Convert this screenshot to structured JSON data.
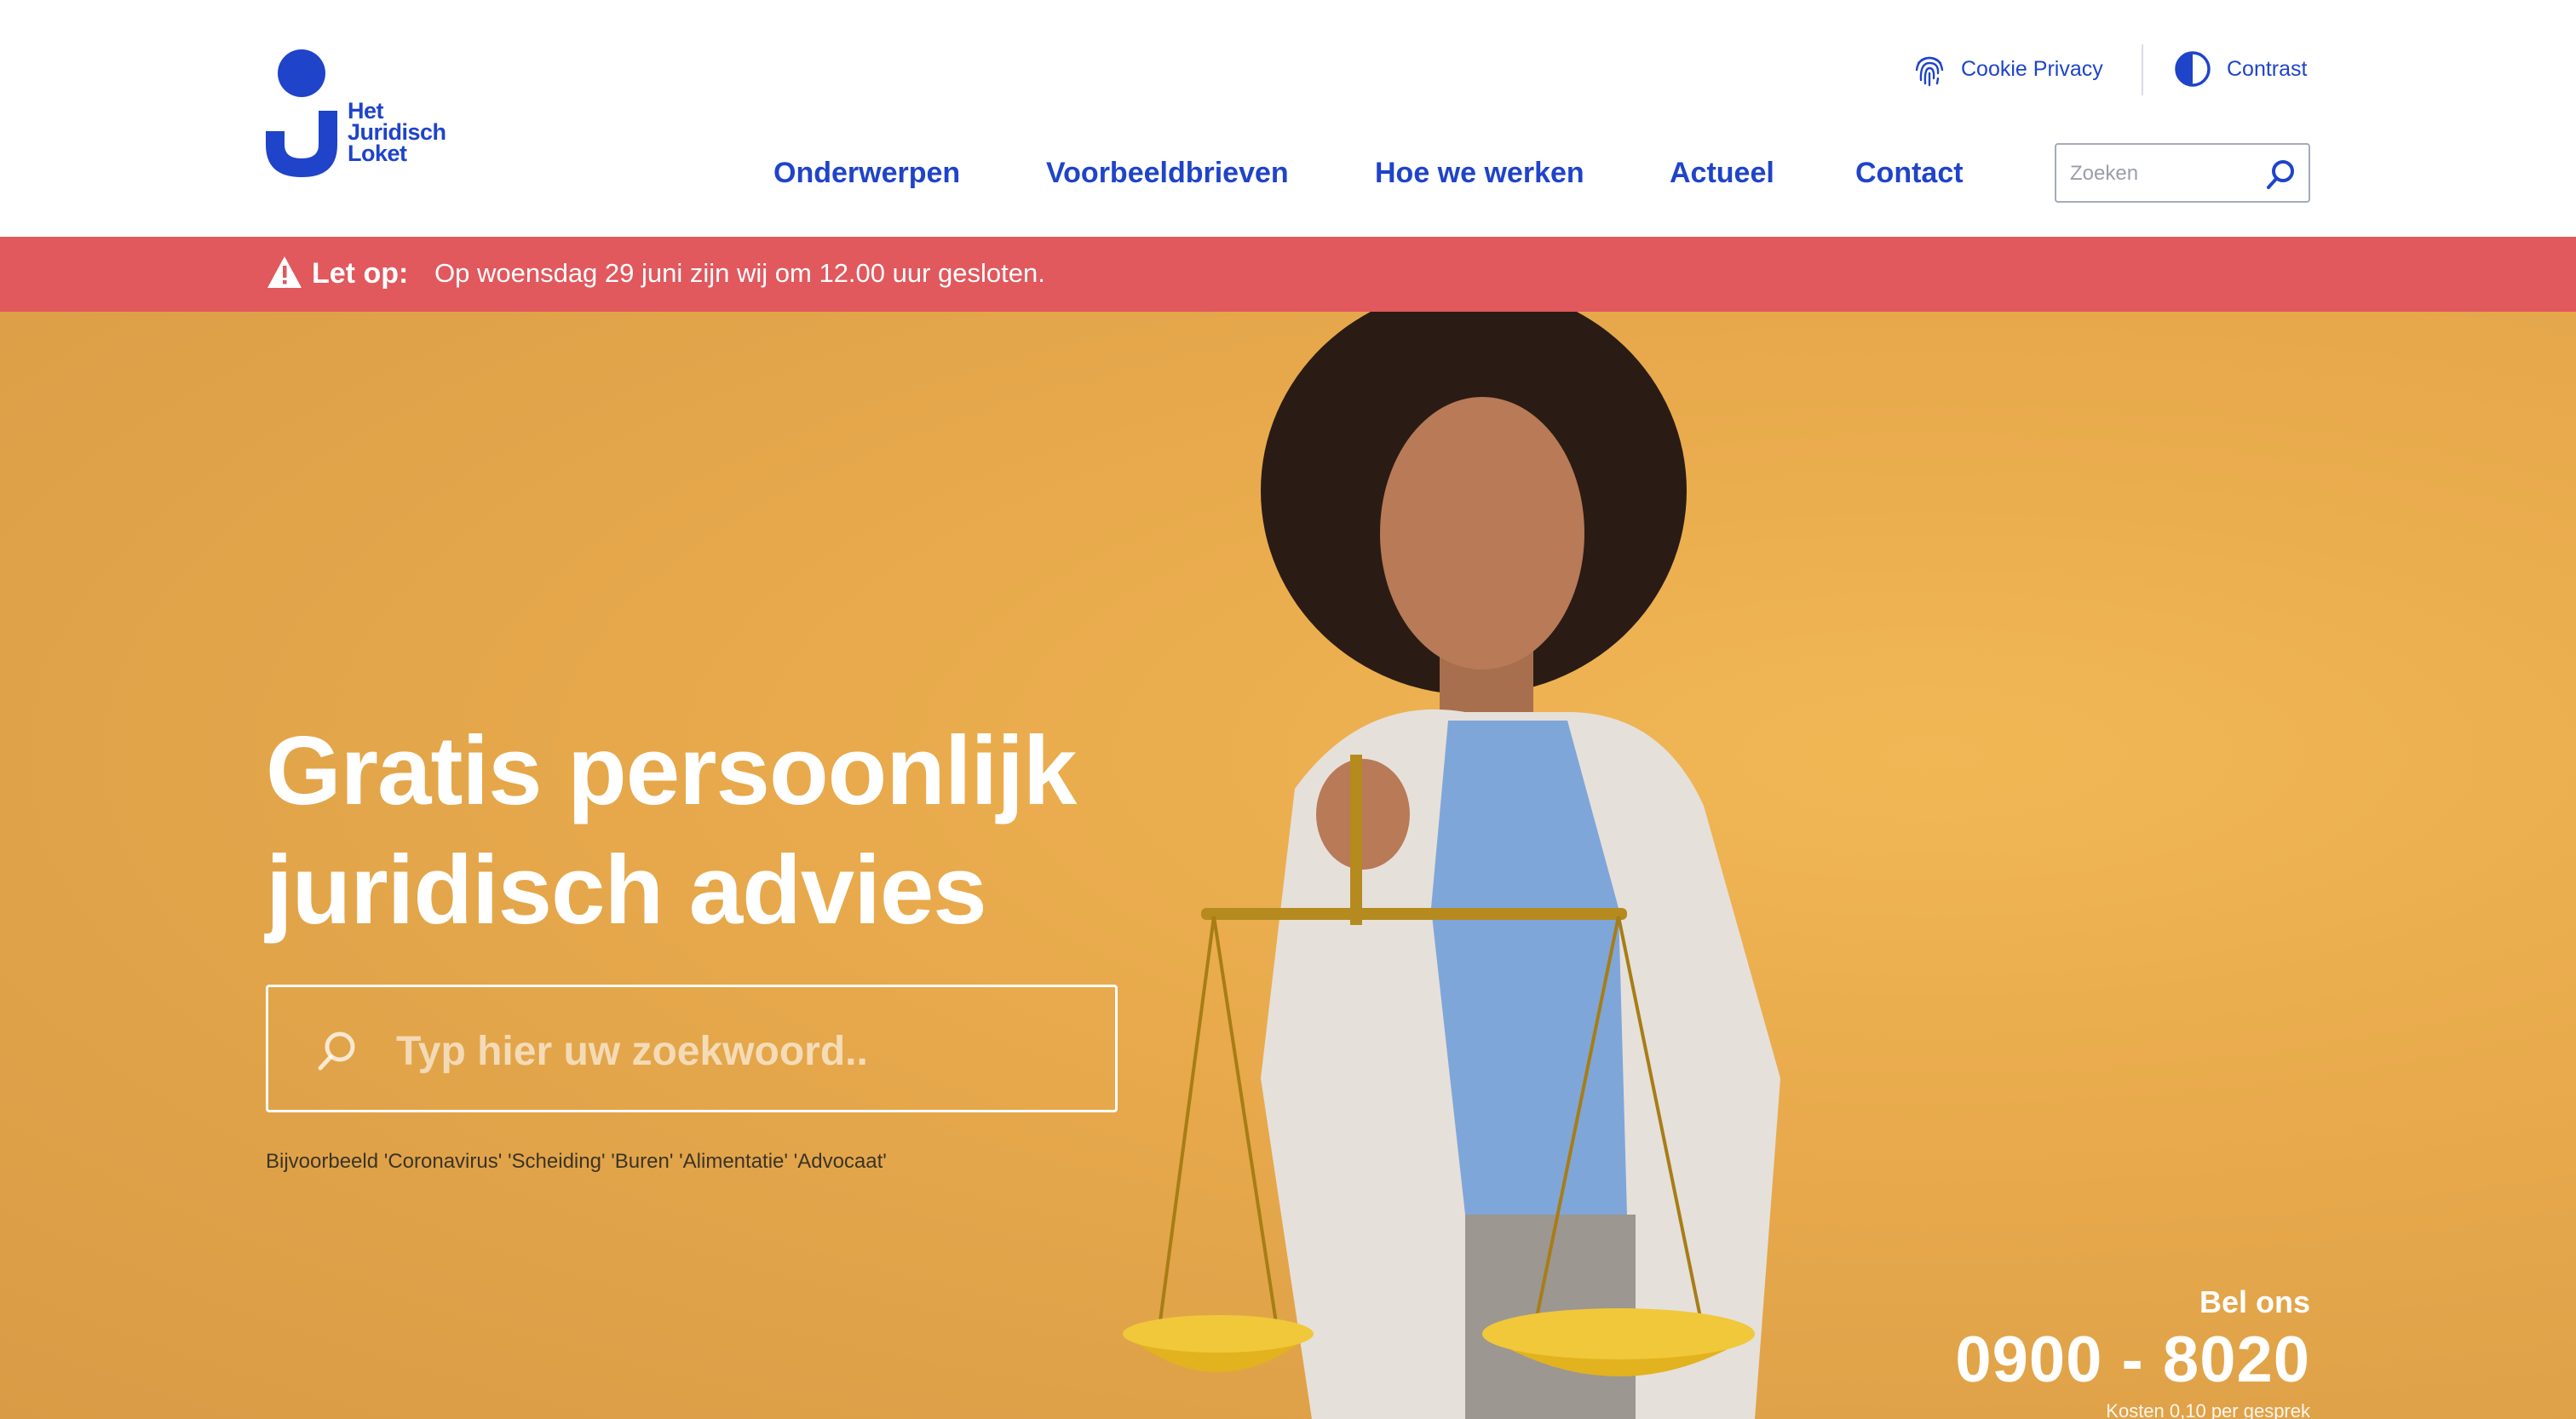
{
  "brand": {
    "name_lines": [
      "Het",
      "Juridisch",
      "Loket"
    ],
    "color": "#1f44c9"
  },
  "utility": {
    "cookie_label": "Cookie Privacy",
    "cookie_icon": "fingerprint-icon",
    "contrast_label": "Contrast",
    "contrast_icon": "contrast-icon"
  },
  "nav": {
    "items": [
      {
        "label": "Onderwerpen"
      },
      {
        "label": "Voorbeeldbrieven"
      },
      {
        "label": "Hoe we werken"
      },
      {
        "label": "Actueel"
      },
      {
        "label": "Contact"
      }
    ]
  },
  "top_search": {
    "placeholder": "Zoeken",
    "icon": "search-icon"
  },
  "alert": {
    "label": "Let op:",
    "message": "Op woensdag 29 juni zijn wij om 12.00 uur gesloten.",
    "icon": "warning-icon",
    "color": "#e1585d"
  },
  "hero": {
    "title_lines": [
      "Gratis persoonlijk",
      "juridisch advies"
    ],
    "search_placeholder": "Typ hier uw zoekwoord..",
    "examples": "Bijvoorbeeld 'Coronavirus' 'Scheiding' 'Buren' 'Alimentatie' 'Advocaat'",
    "background_color": "#e8aa4c"
  },
  "call": {
    "label": "Bel ons",
    "number": "0900 - 8020",
    "sub": "Kosten 0,10 per gesprek"
  }
}
